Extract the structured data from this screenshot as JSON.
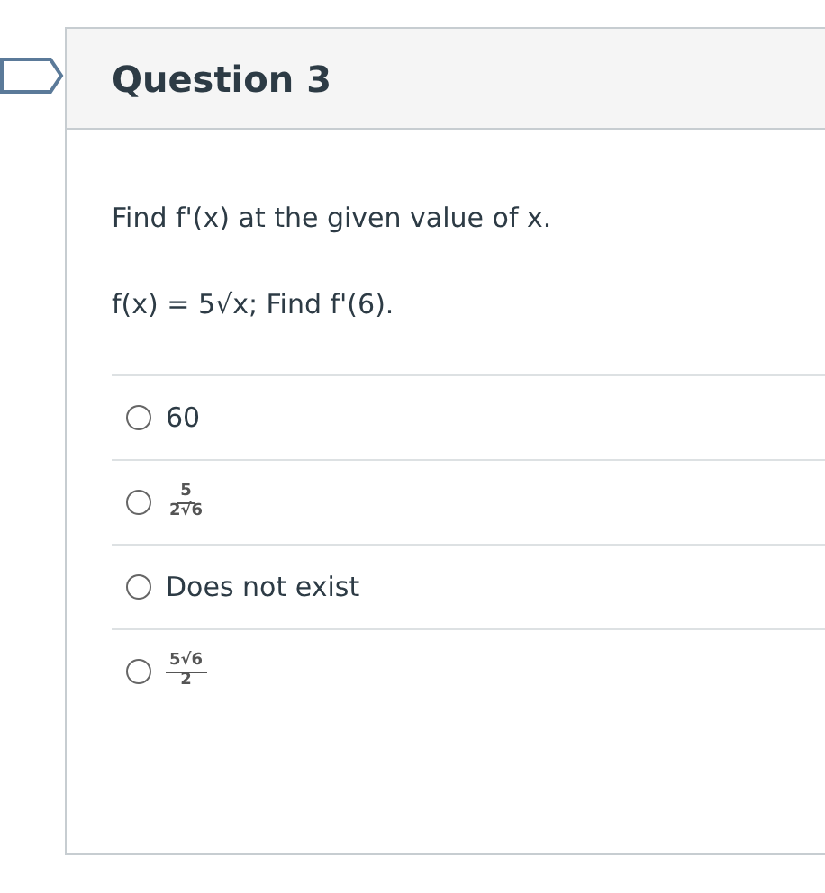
{
  "question": {
    "title": "Question 3",
    "prompt": "Find f'(x) at the given value of x.",
    "formula": "f(x) = 5√x; Find f'(6).",
    "options": [
      {
        "kind": "text",
        "text": "60",
        "selected": false
      },
      {
        "kind": "fraction",
        "numerator": "5",
        "denominator": "2√6",
        "selected": false
      },
      {
        "kind": "text",
        "text": "Does not exist",
        "selected": false
      },
      {
        "kind": "fraction",
        "numerator": "5√6",
        "denominator": "2",
        "selected": false
      }
    ]
  }
}
